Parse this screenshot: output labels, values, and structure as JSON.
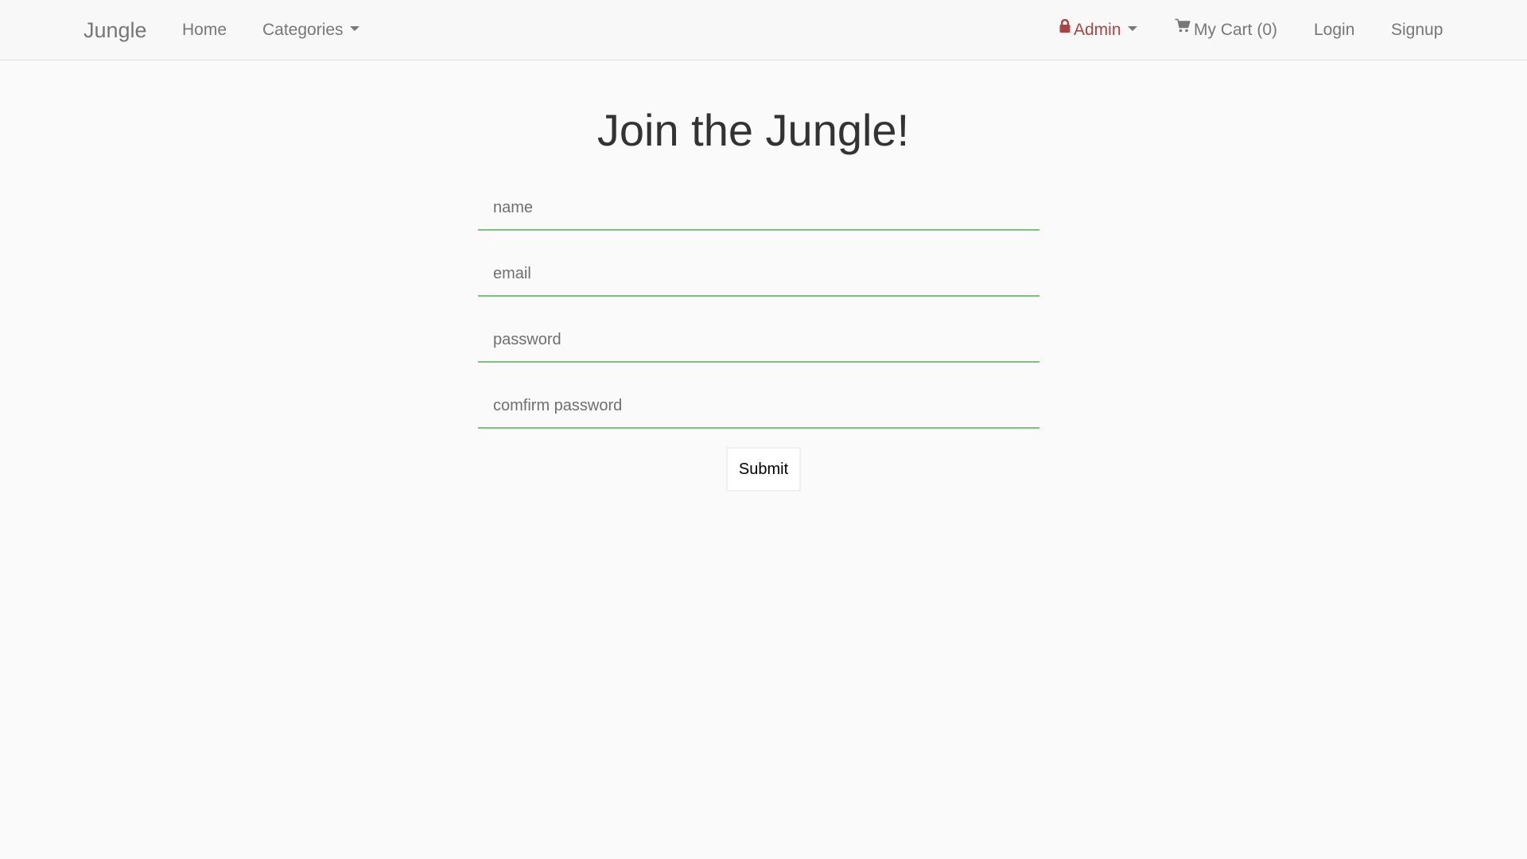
{
  "navbar": {
    "brand": "Jungle",
    "home": "Home",
    "categories": "Categories",
    "admin": "Admin",
    "cart": "My Cart (0)",
    "login": "Login",
    "signup": "Signup"
  },
  "icons": {
    "admin": "lock-icon",
    "cart": "shopping-cart-icon",
    "dropdown": "caret-down-icon"
  },
  "colors": {
    "admin_accent": "#a94442",
    "field_underline": "#7dc17f"
  },
  "page": {
    "title": "Join the Jungle!"
  },
  "form": {
    "name_placeholder": "name",
    "email_placeholder": "email",
    "password_placeholder": "password",
    "confirm_placeholder": "comfirm password",
    "submit_label": "Submit"
  }
}
